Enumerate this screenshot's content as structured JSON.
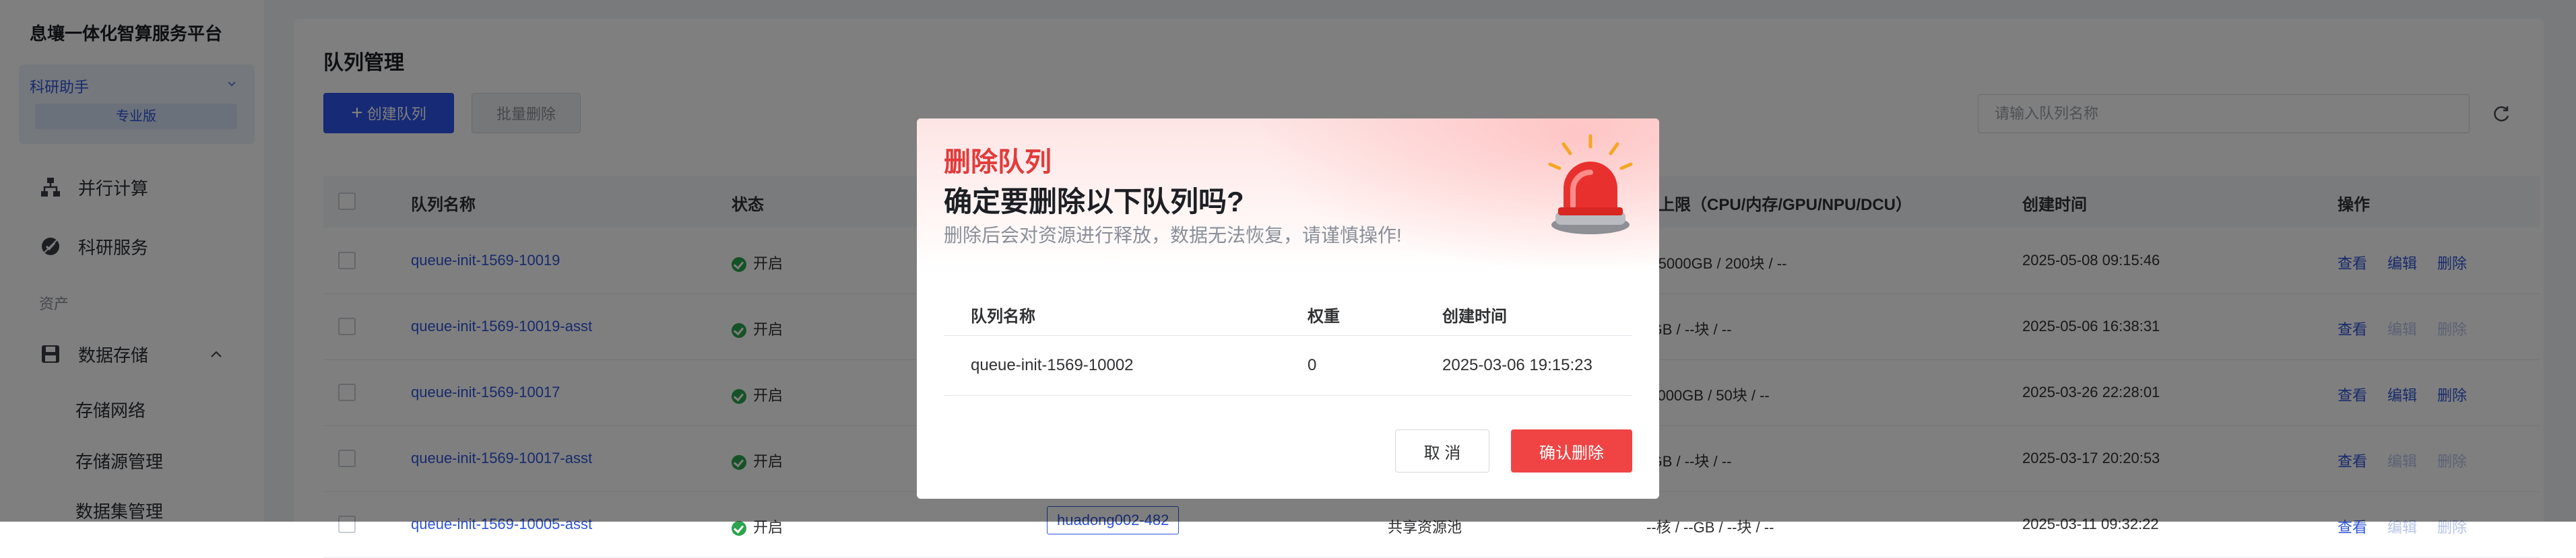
{
  "app": {
    "title": "息壤一体化智算服务平台",
    "assistant": "科研助手",
    "edition": "专业版"
  },
  "sidebar": {
    "items": [
      {
        "label": "并行计算",
        "icon": "network-icon"
      },
      {
        "label": "科研服务",
        "icon": "research-service-icon"
      }
    ],
    "section": "资产",
    "storage": {
      "label": "数据存储",
      "icon": "storage-icon"
    },
    "sub_items": [
      "存储网络",
      "存储源管理",
      "数据集管理"
    ]
  },
  "page": {
    "title": "队列管理",
    "create_button": "创建队列",
    "batch_delete_button": "批量删除",
    "search_placeholder": "请输入队列名称"
  },
  "table": {
    "headers": {
      "name": "队列名称",
      "status": "状态",
      "limit": "资源上限（CPU/内存/GPU/NPU/DCU）",
      "created": "创建时间",
      "actions": "操作"
    },
    "rows": [
      {
        "name": "queue-init-1569-10019",
        "status": "开启",
        "limit": "-核 / 5000GB / 200块 / --",
        "created": "2025-05-08 09:15:46",
        "editable": true
      },
      {
        "name": "queue-init-1569-10019-asst",
        "status": "开启",
        "limit": "--GB / --块 / --",
        "created": "2025-05-06 16:38:31",
        "editable": false
      },
      {
        "name": "queue-init-1569-10017",
        "status": "开启",
        "limit": "/ 5000GB / 50块 / --",
        "created": "2025-03-26 22:28:01",
        "editable": true
      },
      {
        "name": "queue-init-1569-10017-asst",
        "status": "开启",
        "limit": "--GB / --块 / --",
        "created": "2025-03-17 20:20:53",
        "editable": false
      },
      {
        "name": "queue-init-1569-10005-asst",
        "status": "开启",
        "node": "huadong002-482",
        "pool": "共享资源池",
        "limit": "--核 / --GB / --块 / --",
        "created": "2025-03-11 09:32:22",
        "editable": false
      }
    ],
    "action_labels": {
      "view": "查看",
      "edit": "编辑",
      "delete": "删除"
    }
  },
  "modal": {
    "tag": "删除队列",
    "title": "确定要删除以下队列吗?",
    "subtitle": "删除后会对资源进行释放，数据无法恢复，请谨慎操作!",
    "headers": {
      "name": "队列名称",
      "weight": "权重",
      "created": "创建时间"
    },
    "row": {
      "name": "queue-init-1569-10002",
      "weight": "0",
      "created": "2025-03-06 19:15:23"
    },
    "cancel": "取 消",
    "confirm": "确认删除"
  },
  "colors": {
    "primary": "#2f54eb",
    "danger": "#f04444",
    "success": "#2da44e"
  }
}
